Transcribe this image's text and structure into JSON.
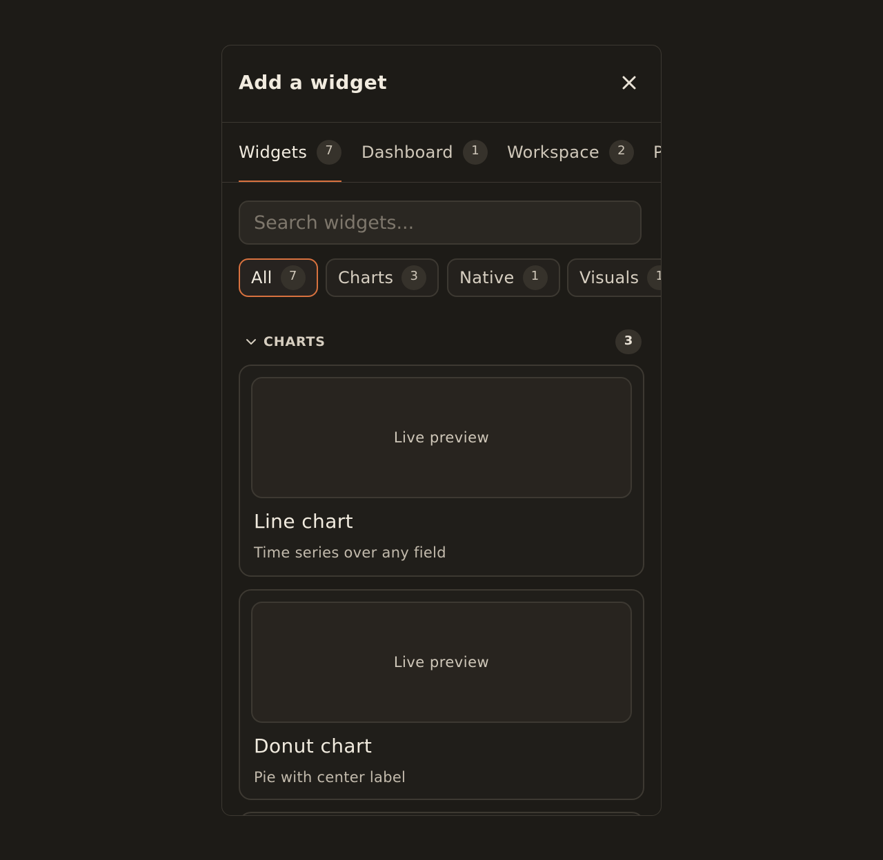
{
  "modal": {
    "title": "Add a widget",
    "close_icon": "close-icon"
  },
  "tabs": [
    {
      "label": "Widgets",
      "count": "7",
      "active": true
    },
    {
      "label": "Dashboard",
      "count": "1",
      "active": false
    },
    {
      "label": "Workspace",
      "count": "2",
      "active": false
    },
    {
      "label": "P",
      "count": "",
      "active": false
    }
  ],
  "search": {
    "placeholder": "Search widgets..."
  },
  "filters": [
    {
      "label": "All",
      "count": "7",
      "active": true
    },
    {
      "label": "Charts",
      "count": "3",
      "active": false
    },
    {
      "label": "Native",
      "count": "1",
      "active": false
    },
    {
      "label": "Visuals",
      "count": "1",
      "active": false
    }
  ],
  "section": {
    "title": "CHARTS",
    "count": "3",
    "chevron_icon": "chevron-down-icon"
  },
  "cards": [
    {
      "preview": "Live preview",
      "title": "Line chart",
      "description": "Time series over any field"
    },
    {
      "preview": "Live preview",
      "title": "Donut chart",
      "description": "Pie with center label"
    }
  ],
  "colors": {
    "background": "#1d1b17",
    "accent": "#d9723f",
    "border": "#3d3932",
    "badge": "#36322b"
  }
}
